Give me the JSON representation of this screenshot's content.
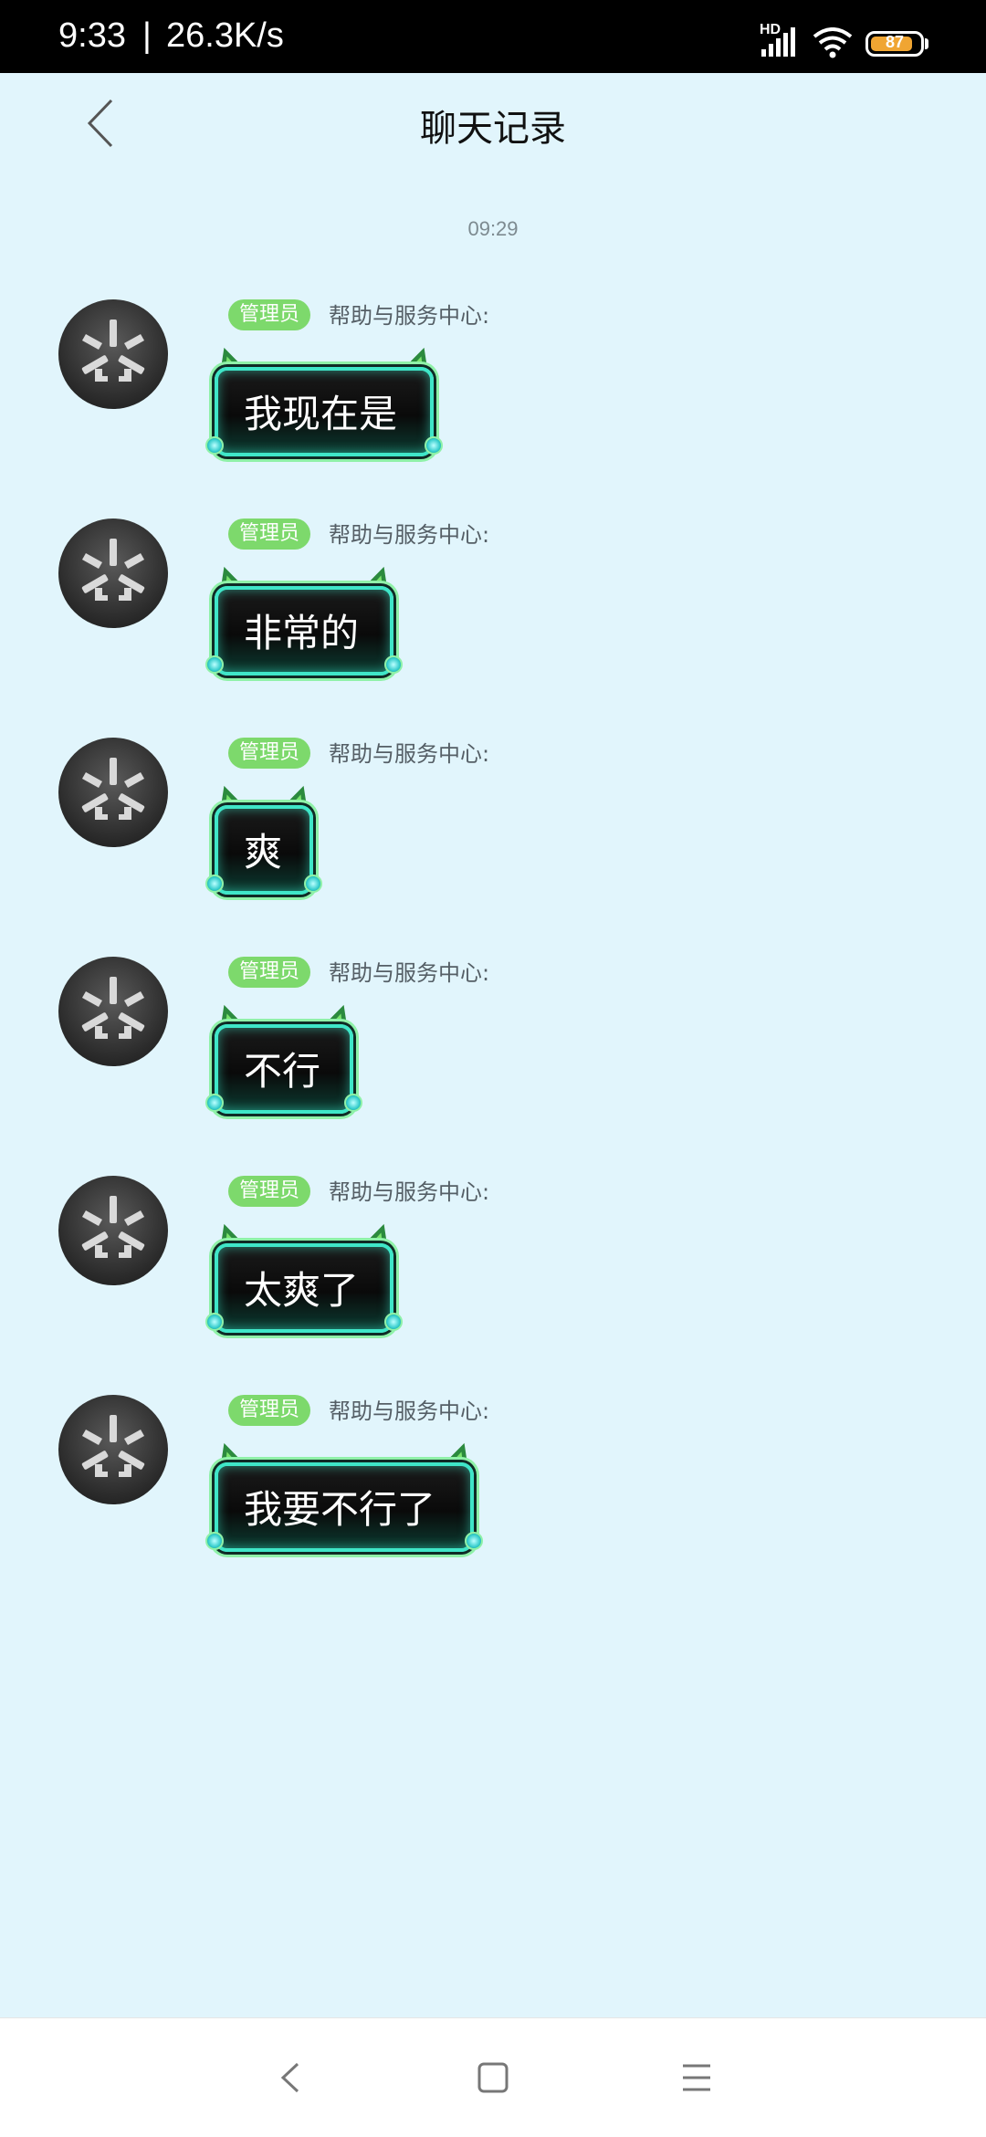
{
  "status_bar": {
    "time": "9:33",
    "separator": "|",
    "network_speed": "26.3K/s",
    "signal_label": "HD",
    "battery": "87",
    "battery_level": 87,
    "battery_color": "#f0a532"
  },
  "header": {
    "title": "聊天记录",
    "back_icon": "chevron-left-icon"
  },
  "timestamp": "09:29",
  "messages": [
    {
      "badge": "管理员",
      "sender": "帮助与服务中心:",
      "text": "我现在是"
    },
    {
      "badge": "管理员",
      "sender": "帮助与服务中心:",
      "text": "非常的"
    },
    {
      "badge": "管理员",
      "sender": "帮助与服务中心:",
      "text": "爽"
    },
    {
      "badge": "管理员",
      "sender": "帮助与服务中心:",
      "text": "不行"
    },
    {
      "badge": "管理员",
      "sender": "帮助与服务中心:",
      "text": "太爽了"
    },
    {
      "badge": "管理员",
      "sender": "帮助与服务中心:",
      "text": "我要不行了"
    }
  ],
  "colors": {
    "background": "#e1f5fc",
    "badge": "#7dd96c",
    "bubble_border": "#3fe6c8"
  },
  "nav_bar": {
    "back_icon": "back-triangle-icon",
    "home_icon": "home-square-icon",
    "menu_icon": "menu-lines-icon"
  }
}
